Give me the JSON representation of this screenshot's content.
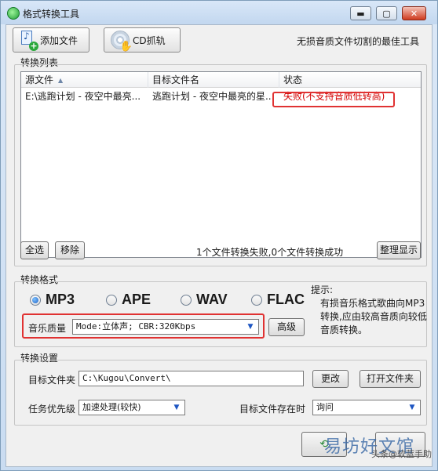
{
  "window": {
    "title": "格式转换工具",
    "minimize_glyph": "▬",
    "maximize_glyph": "▢",
    "close_glyph": "✕"
  },
  "toolbar": {
    "add_file_label": "添加文件",
    "cd_rip_label": "CD抓轨",
    "tagline": "无损音质文件切割的最佳工具"
  },
  "convert_list": {
    "section_label": "转换列表",
    "columns": [
      "源文件",
      "目标文件名",
      "状态"
    ],
    "rows": [
      {
        "source": "E:\\逃跑计划 - 夜空中最亮...",
        "target": "逃跑计划 - 夜空中最亮的星...",
        "status": "失败(不支持音质低转高)"
      }
    ],
    "select_all_label": "全选",
    "remove_label": "移除",
    "summary": "1个文件转换失败,0个文件转换成功",
    "tidy_label": "整理显示"
  },
  "convert_format": {
    "section_label": "转换格式",
    "formats": [
      "MP3",
      "APE",
      "WAV",
      "FLAC"
    ],
    "selected": "MP3",
    "quality_label": "音乐质量",
    "quality_value": "Mode:立体声; CBR:320Kbps",
    "advanced_label": "高级",
    "tip_title": "提示:",
    "tip_text": "有损音乐格式歌曲向MP3转换,应由较高音质向较低音质转换。"
  },
  "convert_settings": {
    "section_label": "转换设置",
    "target_folder_label": "目标文件夹",
    "target_folder_value": "C:\\Kugou\\Convert\\",
    "change_label": "更改",
    "open_folder_label": "打开文件夹",
    "priority_label": "任务优先级",
    "priority_value": "加速处理(较快)",
    "exists_label": "目标文件存在时",
    "exists_value": "询问"
  },
  "watermark": {
    "big": "易坊好文馆",
    "small": "头条@软蓝手助"
  },
  "colors": {
    "accent_blue": "#1f63c6",
    "fail_red": "#d40000",
    "highlight_red": "#e03232"
  }
}
